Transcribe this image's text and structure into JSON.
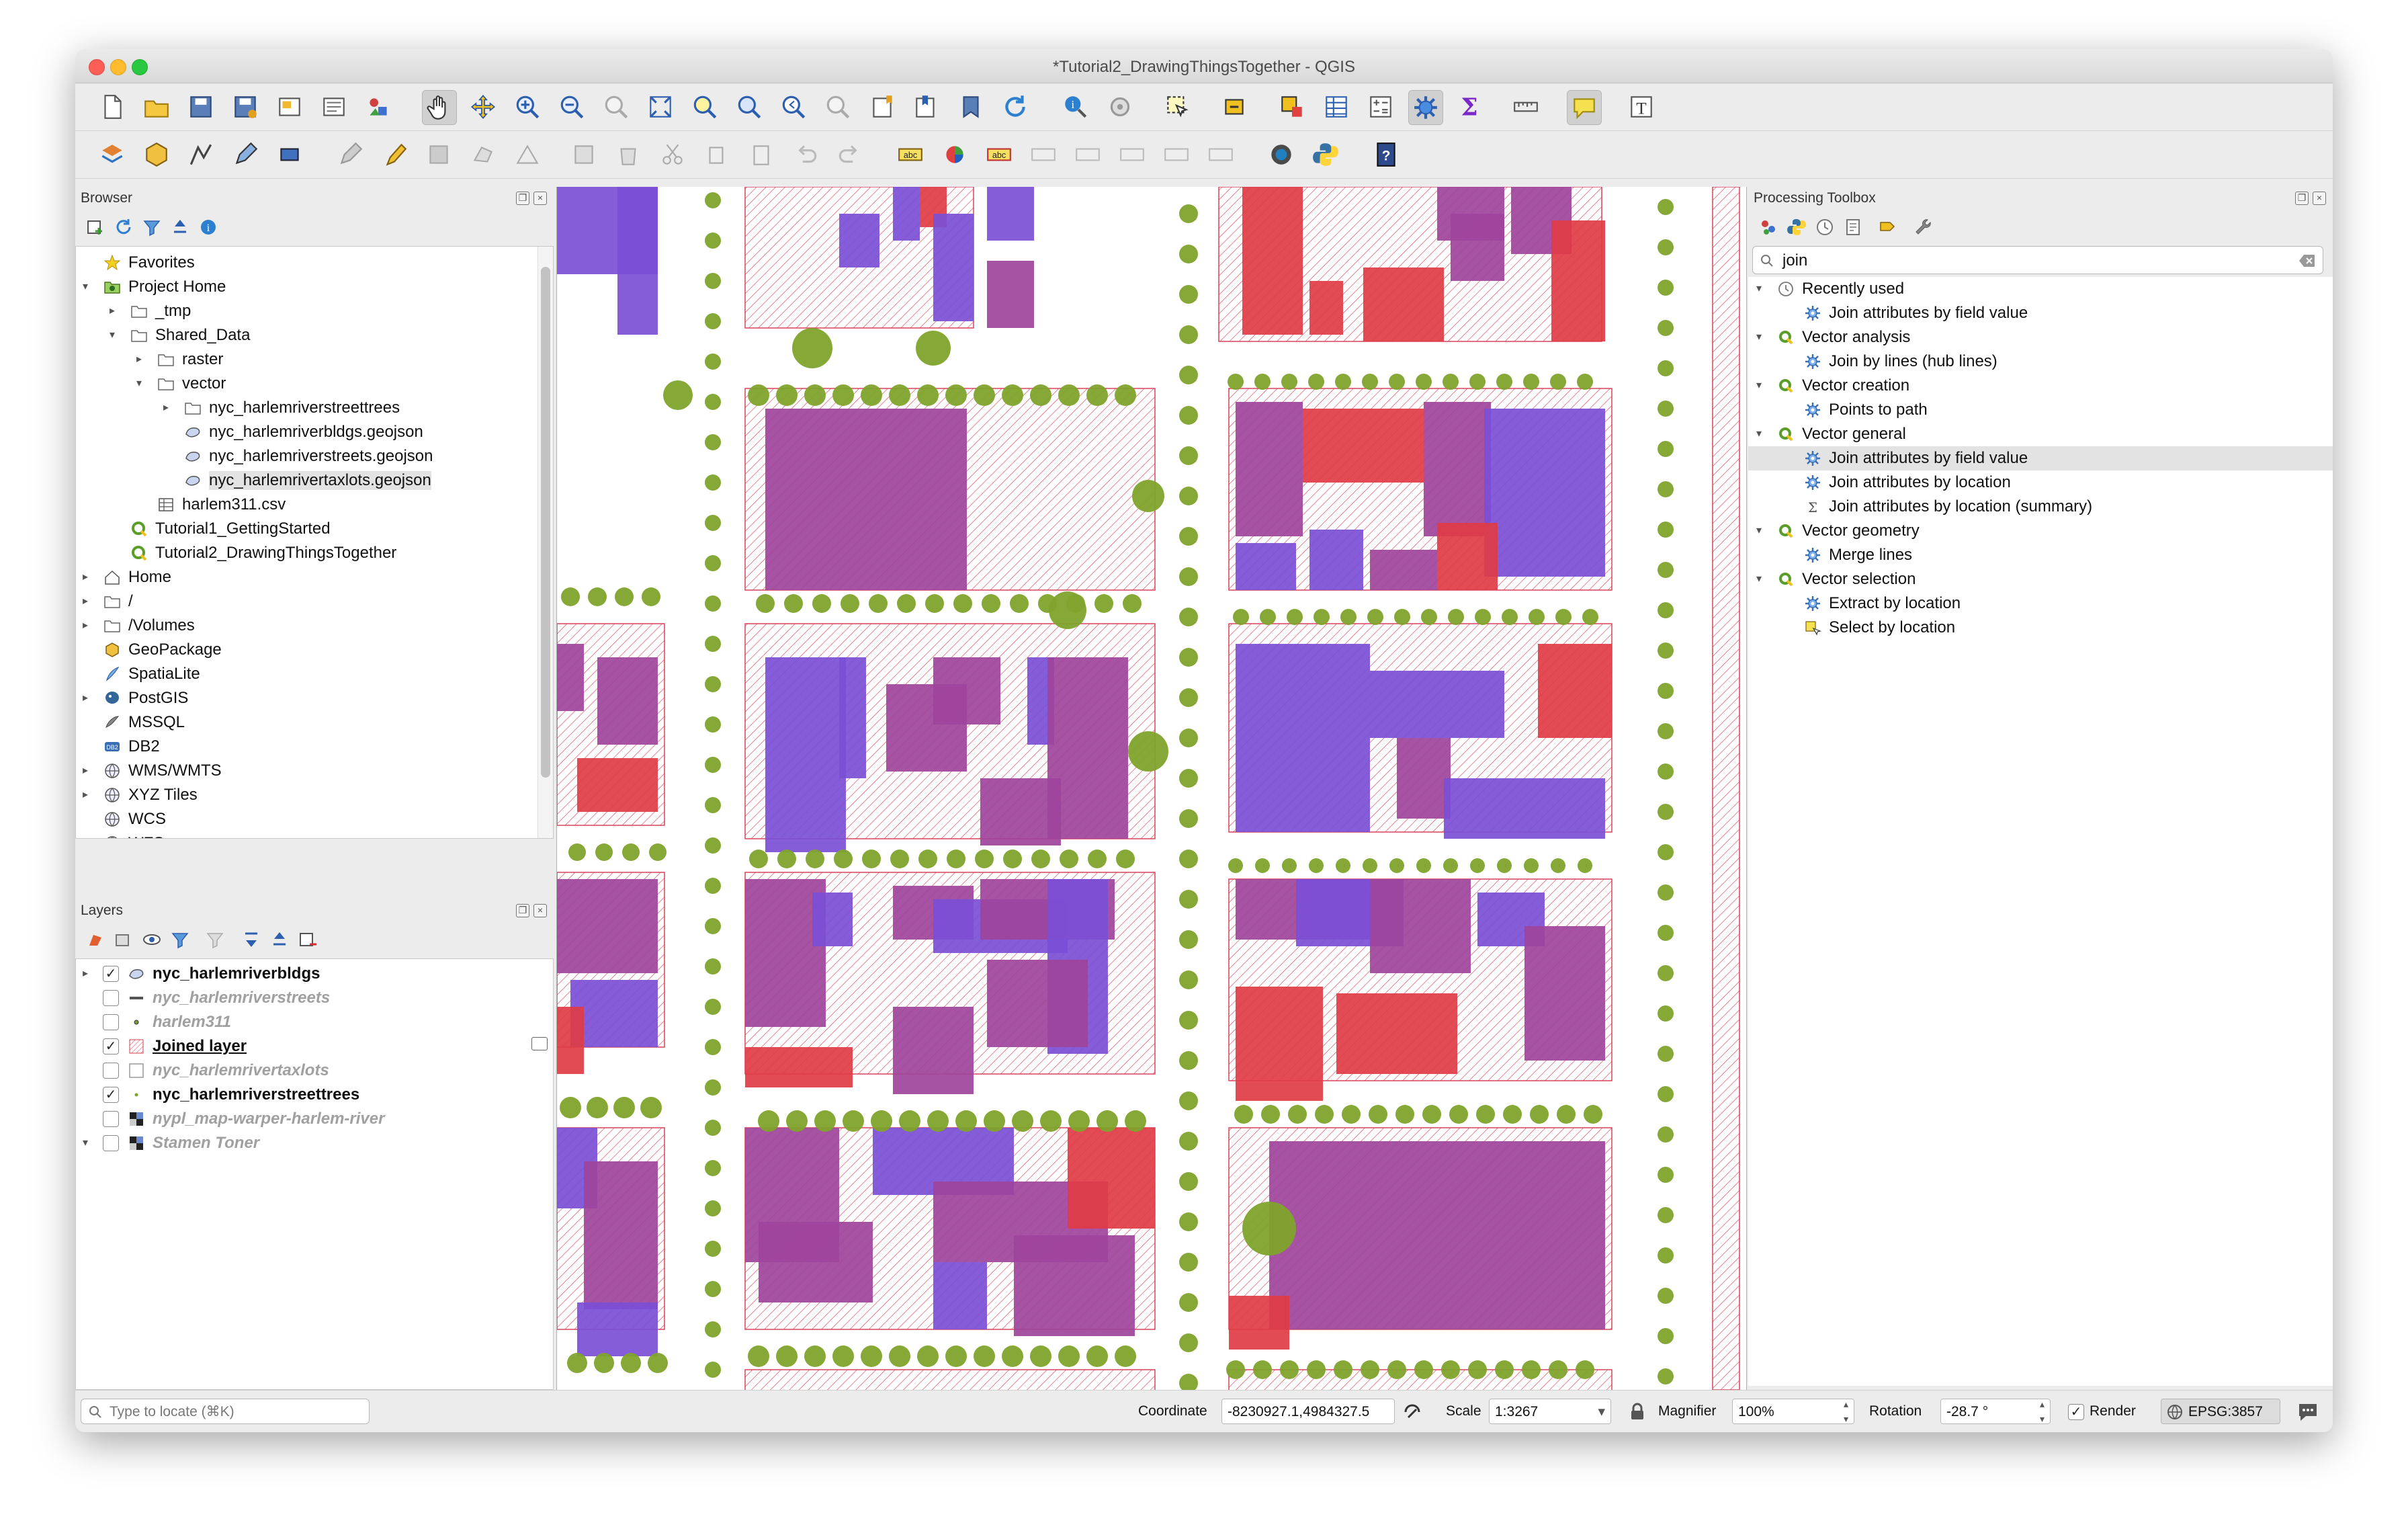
{
  "window": {
    "title": "*Tutorial2_DrawingThingsTogether - QGIS"
  },
  "browser": {
    "title": "Browser",
    "items": [
      {
        "label": "Favorites",
        "icon": "star-icon",
        "level": 0,
        "expander": ""
      },
      {
        "label": "Project Home",
        "icon": "folder-green-icon",
        "level": 0,
        "expander": "open"
      },
      {
        "label": "_tmp",
        "icon": "folder-icon",
        "level": 1,
        "expander": "closed"
      },
      {
        "label": "Shared_Data",
        "icon": "folder-icon",
        "level": 1,
        "expander": "open"
      },
      {
        "label": "raster",
        "icon": "folder-icon",
        "level": 2,
        "expander": "closed"
      },
      {
        "label": "vector",
        "icon": "folder-icon",
        "level": 2,
        "expander": "open"
      },
      {
        "label": "nyc_harlemriverstreettrees",
        "icon": "folder-icon",
        "level": 3,
        "expander": "closed"
      },
      {
        "label": "nyc_harlemriverbldgs.geojson",
        "icon": "polygon-layer-icon",
        "level": 3,
        "expander": ""
      },
      {
        "label": "nyc_harlemriverstreets.geojson",
        "icon": "polygon-layer-icon",
        "level": 3,
        "expander": ""
      },
      {
        "label": "nyc_harlemrivertaxlots.geojson",
        "icon": "polygon-layer-icon",
        "level": 3,
        "expander": "",
        "selected": true
      },
      {
        "label": "harlem311.csv",
        "icon": "table-icon",
        "level": 2,
        "expander": ""
      },
      {
        "label": "Tutorial1_GettingStarted",
        "icon": "qgis-project-icon",
        "level": 1,
        "expander": ""
      },
      {
        "label": "Tutorial2_DrawingThingsTogether",
        "icon": "qgis-project-icon",
        "level": 1,
        "expander": ""
      },
      {
        "label": "Home",
        "icon": "home-icon",
        "level": 0,
        "expander": "closed"
      },
      {
        "label": "/",
        "icon": "folder-icon",
        "level": 0,
        "expander": "closed"
      },
      {
        "label": "/Volumes",
        "icon": "folder-icon",
        "level": 0,
        "expander": "closed"
      },
      {
        "label": "GeoPackage",
        "icon": "geopackage-icon",
        "level": 0,
        "expander": ""
      },
      {
        "label": "SpatiaLite",
        "icon": "spatialite-icon",
        "level": 0,
        "expander": ""
      },
      {
        "label": "PostGIS",
        "icon": "postgis-icon",
        "level": 0,
        "expander": "closed"
      },
      {
        "label": "MSSQL",
        "icon": "mssql-icon",
        "level": 0,
        "expander": ""
      },
      {
        "label": "DB2",
        "icon": "db2-icon",
        "level": 0,
        "expander": ""
      },
      {
        "label": "WMS/WMTS",
        "icon": "globe-icon",
        "level": 0,
        "expander": "closed"
      },
      {
        "label": "XYZ Tiles",
        "icon": "globe-icon",
        "level": 0,
        "expander": "closed"
      },
      {
        "label": "WCS",
        "icon": "globe-icon",
        "level": 0,
        "expander": ""
      },
      {
        "label": "WFS",
        "icon": "globe-icon",
        "level": 0,
        "expander": ""
      }
    ]
  },
  "layers": {
    "title": "Layers",
    "items": [
      {
        "label": "nyc_harlemriverbldgs",
        "checked": true,
        "style": "bold",
        "icon": "polygon-layer-icon",
        "expander": "closed"
      },
      {
        "label": "nyc_harlemriverstreets",
        "checked": false,
        "style": "ital",
        "icon": "line-layer-icon",
        "expander": ""
      },
      {
        "label": "harlem311",
        "checked": false,
        "style": "ital",
        "icon": "point-layer-icon",
        "expander": ""
      },
      {
        "label": "Joined layer",
        "checked": true,
        "style": "bold-underline",
        "icon": "hatched-polygon-icon",
        "expander": ""
      },
      {
        "label": "nyc_harlemrivertaxlots",
        "checked": false,
        "style": "ital",
        "icon": "empty-polygon-icon",
        "expander": ""
      },
      {
        "label": "nyc_harlemriverstreettrees",
        "checked": true,
        "style": "bold",
        "icon": "point-green-icon",
        "expander": ""
      },
      {
        "label": "nypl_map-warper-harlem-river",
        "checked": false,
        "style": "ital",
        "icon": "raster-icon",
        "expander": ""
      },
      {
        "label": "Stamen Toner",
        "checked": false,
        "style": "ital",
        "icon": "raster-icon",
        "expander": "open"
      }
    ]
  },
  "processing": {
    "title": "Processing Toolbox",
    "search_value": "join",
    "items": [
      {
        "label": "Recently used",
        "icon": "clock-icon",
        "level": 0,
        "expander": "open"
      },
      {
        "label": "Join attributes by field value",
        "icon": "gear-blue-icon",
        "level": 1,
        "expander": ""
      },
      {
        "label": "Vector analysis",
        "icon": "qgis-q-icon",
        "level": 0,
        "expander": "open"
      },
      {
        "label": "Join by lines (hub lines)",
        "icon": "gear-blue-icon",
        "level": 1,
        "expander": ""
      },
      {
        "label": "Vector creation",
        "icon": "qgis-q-icon",
        "level": 0,
        "expander": "open"
      },
      {
        "label": "Points to path",
        "icon": "gear-blue-icon",
        "level": 1,
        "expander": ""
      },
      {
        "label": "Vector general",
        "icon": "qgis-q-icon",
        "level": 0,
        "expander": "open"
      },
      {
        "label": "Join attributes by field value",
        "icon": "gear-blue-icon",
        "level": 1,
        "expander": "",
        "selected": true
      },
      {
        "label": "Join attributes by location",
        "icon": "gear-blue-icon",
        "level": 1,
        "expander": ""
      },
      {
        "label": "Join attributes by location (summary)",
        "icon": "sigma-icon",
        "level": 1,
        "expander": ""
      },
      {
        "label": "Vector geometry",
        "icon": "qgis-q-icon",
        "level": 0,
        "expander": "open"
      },
      {
        "label": "Merge lines",
        "icon": "gear-blue-icon",
        "level": 1,
        "expander": ""
      },
      {
        "label": "Vector selection",
        "icon": "qgis-q-icon",
        "level": 0,
        "expander": "open"
      },
      {
        "label": "Extract by location",
        "icon": "gear-blue-icon",
        "level": 1,
        "expander": ""
      },
      {
        "label": "Select by location",
        "icon": "select-location-icon",
        "level": 1,
        "expander": ""
      }
    ]
  },
  "status": {
    "locate_placeholder": "Type to locate (⌘K)",
    "coordinate_label": "Coordinate",
    "coordinate_value": "-8230927.1,4984327.5",
    "scale_label": "Scale",
    "scale_value": "1:3267",
    "magnifier_label": "Magnifier",
    "magnifier_value": "100%",
    "rotation_label": "Rotation",
    "rotation_value": "-28.7 °",
    "render_label": "Render",
    "crs_value": "EPSG:3857"
  },
  "colors": {
    "building_purple": "#7b4fd6",
    "building_red": "#e03c45",
    "building_magenta": "#a0449c",
    "taxlot_hatch": "#d8445a",
    "tree_green": "#7fa32c"
  }
}
